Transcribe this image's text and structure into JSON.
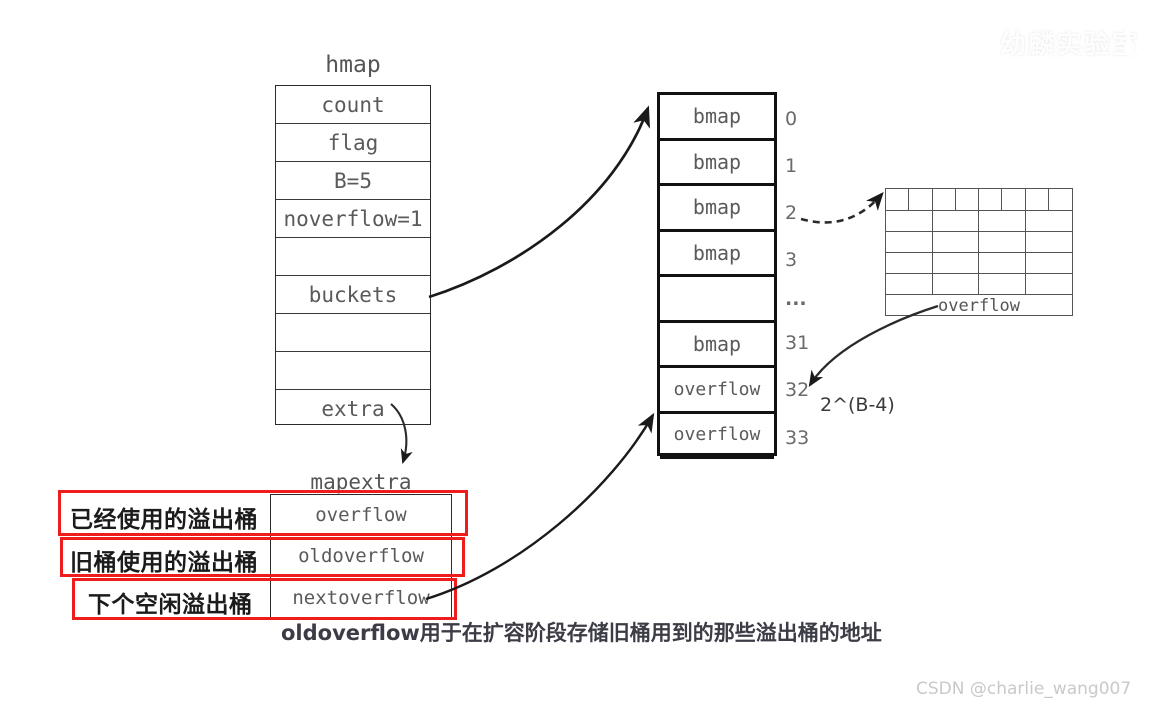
{
  "diagram": {
    "title_hmap": "hmap",
    "title_mapextra": "mapextra",
    "hmap_fields": [
      {
        "label": "count"
      },
      {
        "label": "flag"
      },
      {
        "label": "B=5"
      },
      {
        "label": "noverflow=1"
      },
      {
        "label": ""
      },
      {
        "label": "buckets"
      },
      {
        "label": ""
      },
      {
        "label": ""
      },
      {
        "label": "extra"
      }
    ],
    "buckets_cells": [
      {
        "label": "bmap",
        "index": "0"
      },
      {
        "label": "bmap",
        "index": "1"
      },
      {
        "label": "bmap",
        "index": "2"
      },
      {
        "label": "bmap",
        "index": "3"
      },
      {
        "label": "",
        "index": "..."
      },
      {
        "label": "bmap",
        "index": "31"
      },
      {
        "label": "overflow",
        "index": "32"
      },
      {
        "label": "overflow",
        "index": "33"
      }
    ],
    "overflow_count_label": "2^(B-4)",
    "overflow_grid": {
      "footer_label": "overflow",
      "top_row_cells": 8,
      "body_rows": 4,
      "body_row_cells": 4
    },
    "mapextra_fields": [
      {
        "label": "overflow",
        "annotation": "已经使用的溢出桶"
      },
      {
        "label": "oldoverflow",
        "annotation": "旧桶使用的溢出桶"
      },
      {
        "label": "nextoverflow",
        "annotation": "下个空闲溢出桶"
      }
    ],
    "bottom_caption": "oldoverflow用于在扩容阶段存储旧桶用到的那些溢出桶的地址",
    "watermark_top": "幼麟实验室",
    "csdn_credit": "CSDN @charlie_wang007",
    "colors": {
      "annotation_red": "#ee1c1c",
      "stroke_dark": "#1a1a1a",
      "text_gray": "#5a5a5a"
    }
  }
}
